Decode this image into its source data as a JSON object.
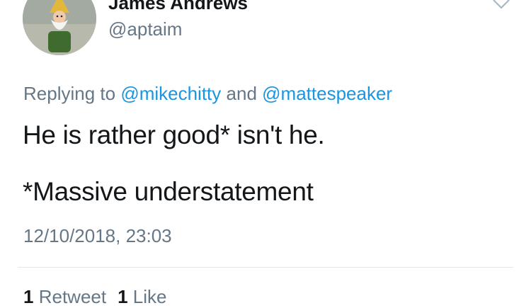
{
  "tweet": {
    "author": {
      "display_name": "James Andrews",
      "handle": "@aptaim",
      "avatar_icon": "garden-gnome-avatar"
    },
    "menu_icon": "chevron-down-icon",
    "reply": {
      "prefix": "Replying to",
      "mention_1": "@mikechitty",
      "joiner": "and",
      "mention_2": "@mattespeaker"
    },
    "text_line_1": "He is rather good* isn't he.",
    "text_line_2": "*Massive understatement",
    "timestamp": "12/10/2018, 23:03",
    "stats": {
      "retweets_count": "1",
      "retweets_label": "Retweet",
      "likes_count": "1",
      "likes_label": "Like"
    }
  },
  "colors": {
    "text": "#14171a",
    "secondary": "#657786",
    "link": "#1b95e0",
    "divider": "#e1e8ed"
  }
}
